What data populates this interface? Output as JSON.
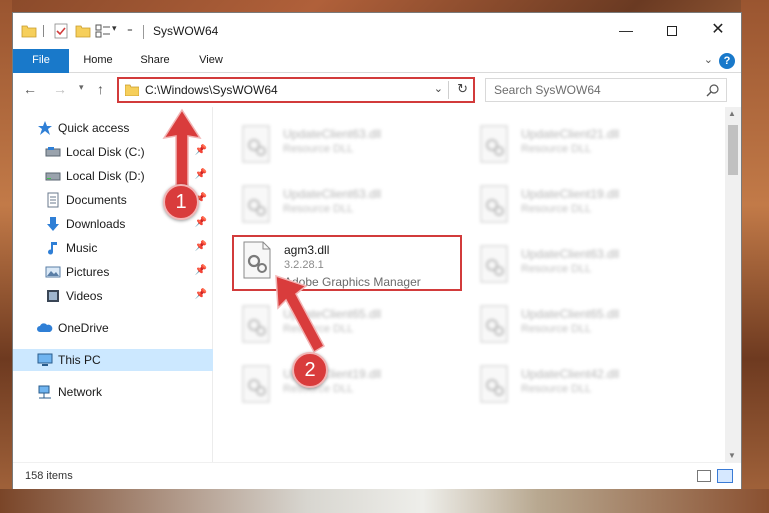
{
  "window": {
    "title": "SysWOW64",
    "controls": {
      "minimize": "—",
      "maximize": "",
      "close": "✕"
    }
  },
  "ribbon": {
    "tabs": [
      "File",
      "Home",
      "Share",
      "View"
    ],
    "help": "?"
  },
  "address": {
    "path": "C:\\Windows\\SysWOW64",
    "search_placeholder": "Search SysWOW64"
  },
  "sidebar": {
    "items": [
      {
        "label": "Quick access",
        "icon": "star-icon",
        "pinned": false
      },
      {
        "label": "Local Disk (C:)",
        "icon": "drive-icon",
        "pinned": true
      },
      {
        "label": "Local Disk (D:)",
        "icon": "drive-icon",
        "pinned": true
      },
      {
        "label": "Documents",
        "icon": "documents-icon",
        "pinned": true
      },
      {
        "label": "Downloads",
        "icon": "download-icon",
        "pinned": true
      },
      {
        "label": "Music",
        "icon": "music-icon",
        "pinned": true
      },
      {
        "label": "Pictures",
        "icon": "pictures-icon",
        "pinned": true
      },
      {
        "label": "Videos",
        "icon": "videos-icon",
        "pinned": true
      },
      {
        "label": "OneDrive",
        "icon": "cloud-icon",
        "pinned": false
      },
      {
        "label": "This PC",
        "icon": "computer-icon",
        "pinned": false,
        "selected": true
      },
      {
        "label": "Network",
        "icon": "network-icon",
        "pinned": false
      }
    ]
  },
  "files": [
    {
      "name": "UpdateClient63.dll",
      "desc": "Resource DLL",
      "blurred": true
    },
    {
      "name": "UpdateClient21.dll",
      "desc": "Resource DLL",
      "blurred": true
    },
    {
      "name": "UpdateClient63.dll",
      "desc": "Resource DLL",
      "blurred": true
    },
    {
      "name": "UpdateClient19.dll",
      "desc": "Resource DLL",
      "blurred": true
    },
    {
      "name": "agm3.dll",
      "version": "3.2.28.1",
      "desc": "Adobe Graphics Manager",
      "blurred": false,
      "highlighted": true
    },
    {
      "name": "UpdateClient63.dll",
      "desc": "Resource DLL",
      "blurred": true
    },
    {
      "name": "UpdateClient65.dll",
      "desc": "Resource DLL",
      "blurred": true
    },
    {
      "name": "UpdateClient65.dll",
      "desc": "Resource DLL",
      "blurred": true
    },
    {
      "name": "UpdateClient19.dll",
      "desc": "Resource DLL",
      "blurred": true
    },
    {
      "name": "UpdateClient42.dll",
      "desc": "Resource DLL",
      "blurred": true
    }
  ],
  "status": {
    "item_count": "158 items"
  },
  "annotations": {
    "step1": "1",
    "step2": "2",
    "color": "#d23b3b"
  }
}
